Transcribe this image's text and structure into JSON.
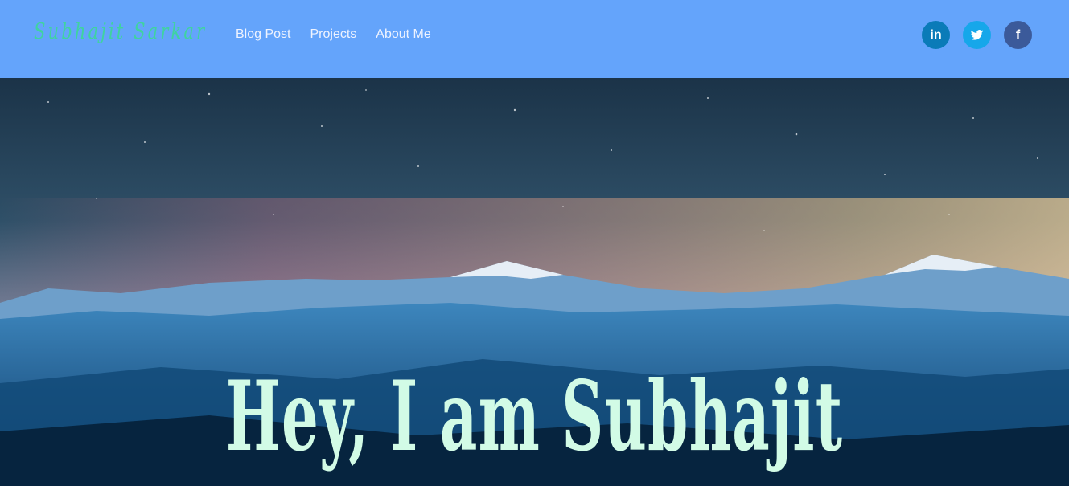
{
  "header": {
    "brand": "Subhajit Sarkar",
    "nav": [
      {
        "label": "Blog Post"
      },
      {
        "label": "Projects"
      },
      {
        "label": "About Me"
      }
    ],
    "socials": [
      {
        "icon": "linkedin-icon",
        "text": "in",
        "color": "#0a7bb8"
      },
      {
        "icon": "twitter-icon",
        "color": "#16a7ea"
      },
      {
        "icon": "facebook-icon",
        "text": "f",
        "color": "#3b5a9a"
      }
    ],
    "background": "#64a4fb",
    "brand_color": "#3fd3a0"
  },
  "hero": {
    "title": "Hey, I am Subhajit",
    "title_color": "#d2fbe6"
  }
}
